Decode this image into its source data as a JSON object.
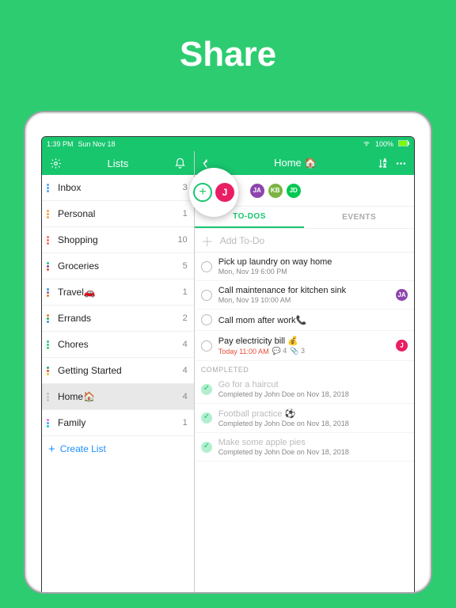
{
  "hero": {
    "title": "Share"
  },
  "statusbar": {
    "time": "1:39 PM",
    "date": "Sun Nov 18",
    "wifi": "wifi-icon",
    "battery_pct": "100%"
  },
  "left_panel": {
    "title": "Lists",
    "settings_icon": "gear-icon",
    "notify_icon": "bell-icon",
    "create_label": "Create List",
    "items": [
      {
        "name": "Inbox",
        "count": "3",
        "colors": [
          "#4aa3ff",
          "#4aa3ff",
          "#4aa3ff"
        ]
      },
      {
        "name": "Personal",
        "count": "1",
        "colors": [
          "#ff9f43",
          "#ff9f43",
          "#ff9f43"
        ]
      },
      {
        "name": "Shopping",
        "count": "10",
        "colors": [
          "#ff6b6b",
          "#ff6b6b",
          "#ff6b6b"
        ]
      },
      {
        "name": "Groceries",
        "count": "5",
        "colors": [
          "#1abc9c",
          "#8e44ad",
          "#e74c3c"
        ]
      },
      {
        "name": "Travel🚗",
        "count": "1",
        "colors": [
          "#3498db",
          "#9b59b6",
          "#e67e22"
        ]
      },
      {
        "name": "Errands",
        "count": "2",
        "colors": [
          "#e67e22",
          "#27ae60",
          "#3498db"
        ]
      },
      {
        "name": "Chores",
        "count": "4",
        "colors": [
          "#2ecc71",
          "#2ecc71",
          "#2ecc71"
        ]
      },
      {
        "name": "Getting Started",
        "count": "4",
        "colors": [
          "#27ae60",
          "#e74c3c",
          "#f1c40f"
        ]
      },
      {
        "name": "Home🏠",
        "count": "4",
        "colors": [
          "#bdc3c7",
          "#bdc3c7",
          "#bdc3c7"
        ],
        "selected": true
      },
      {
        "name": "Family",
        "count": "1",
        "colors": [
          "#f368e0",
          "#54a0ff",
          "#00d2d3"
        ]
      }
    ]
  },
  "right_panel": {
    "title": "Home 🏠",
    "back_icon": "back-arrow-icon",
    "sort_icon": "sort-az-icon",
    "more_icon": "more-icon",
    "avatars": [
      {
        "initials": "JA",
        "bg": "#8e44ad"
      },
      {
        "initials": "KB",
        "bg": "#7cb342"
      },
      {
        "initials": "JD",
        "bg": "#00c853"
      }
    ],
    "tabs": {
      "todos": "TO-DOS",
      "events": "EVENTS"
    },
    "add_placeholder": "Add To-Do",
    "completed_header": "COMPLETED",
    "todos": [
      {
        "title": "Pick up laundry on way home",
        "sub": "Mon, Nov 19 6:00 PM"
      },
      {
        "title": "Call maintenance for kitchen sink",
        "sub": "Mon, Nov 19 10:00 AM",
        "badge": {
          "initials": "JA",
          "bg": "#8e44ad"
        }
      },
      {
        "title": "Call mom after work📞",
        "sub": ""
      },
      {
        "title": "Pay electricity bill 💰",
        "sub_red": "Today 11:00 AM",
        "sub_extra_1": "💬 4",
        "sub_extra_2": "📎 3",
        "badge": {
          "initials": "J",
          "bg": "#e91e63"
        }
      }
    ],
    "completed": [
      {
        "title": "Go for a haircut",
        "sub": "Completed by John Doe on Nov 18, 2018"
      },
      {
        "title": "Football practice ⚽",
        "sub": "Completed by John Doe on Nov 18, 2018"
      },
      {
        "title": "Make some apple pies",
        "sub": "Completed by John Doe on Nov 18, 2018"
      }
    ]
  },
  "spotlight": {
    "add_label": "+",
    "user_initial": "J"
  }
}
